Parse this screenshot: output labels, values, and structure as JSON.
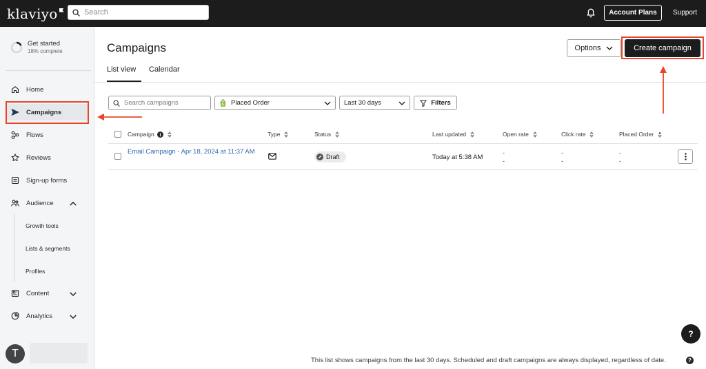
{
  "brand": {
    "logo_text": "klaviyo",
    "accent_red": "#e8452c",
    "dark": "#1c1c1c",
    "link_blue": "#2f6bb2"
  },
  "topbar": {
    "search_placeholder": "Search",
    "account_plans_label": "Account Plans",
    "support_label": "Support",
    "icons": [
      "search-icon",
      "bell-icon"
    ]
  },
  "sidebar": {
    "get_started": {
      "title": "Get started",
      "progress_text": "18% complete",
      "progress": 0.18
    },
    "items": {
      "home": "Home",
      "campaigns": "Campaigns",
      "flows": "Flows",
      "reviews": "Reviews",
      "signup_forms": "Sign-up forms",
      "audience": "Audience",
      "content": "Content",
      "analytics": "Analytics"
    },
    "audience_sub": {
      "growth_tools": "Growth tools",
      "lists_segments": "Lists & segments",
      "profiles": "Profiles"
    },
    "active_item": "Campaigns",
    "avatar_initial": "T"
  },
  "header": {
    "title": "Campaigns",
    "options_label": "Options",
    "create_label": "Create campaign"
  },
  "tabs": {
    "list_view": "List view",
    "calendar": "Calendar",
    "active": "List view"
  },
  "filters": {
    "search_placeholder": "Search campaigns",
    "metric_value": "Placed Order",
    "date_range_value": "Last 30 days",
    "filters_label": "Filters"
  },
  "table": {
    "columns": {
      "campaign": "Campaign",
      "type": "Type",
      "status": "Status",
      "last_updated": "Last updated",
      "open_rate": "Open rate",
      "click_rate": "Click rate",
      "placed_order": "Placed Order"
    },
    "rows": [
      {
        "name": "Email Campaign - Apr 18, 2024 at 11:37 AM",
        "type_icon": "envelope-icon",
        "status": "Draft",
        "last_updated": "Today at 5:38 AM",
        "open_rate": "-",
        "open_rate_sub": "-",
        "click_rate": "-",
        "click_rate_sub": "-",
        "placed_order": "-",
        "placed_order_sub": "-"
      }
    ]
  },
  "footer": {
    "note": "This list shows campaigns from the last 30 days. Scheduled and draft campaigns are always displayed, regardless of date.",
    "help_glyph": "?"
  },
  "help_fab_glyph": "?"
}
